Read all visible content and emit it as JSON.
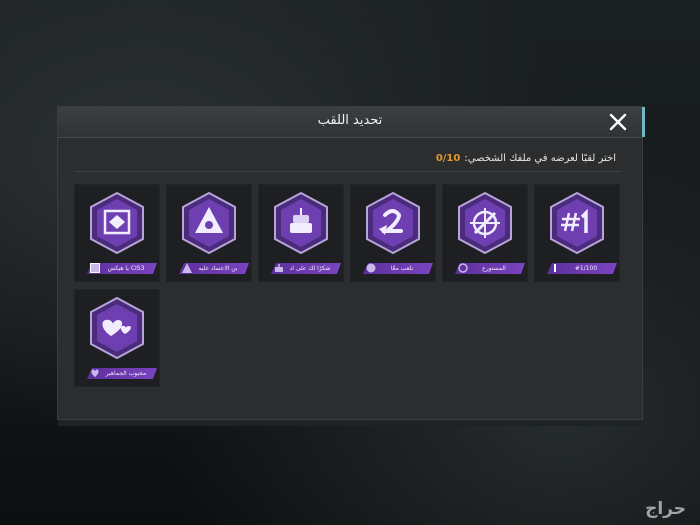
{
  "dialog": {
    "title": "تحديد اللقب",
    "instruction": "اختر لقبًا لعرضه في ملفك الشخصي:",
    "count": "0/10"
  },
  "titles": [
    {
      "label": "CIS3 يا هيكس",
      "icon": "cube-icon"
    },
    {
      "label": "بن الاعتماد عليه",
      "icon": "pyramid-eye-icon"
    },
    {
      "label": "شكرًا لك على اد",
      "icon": "cake-icon"
    },
    {
      "label": "نلعب معًا",
      "icon": "two-player-icon"
    },
    {
      "label": "المستورع",
      "icon": "crosshair-icon"
    },
    {
      "label": "#1/100",
      "icon": "rank-one-icon"
    },
    {
      "label": "محبوب الجماهير",
      "icon": "hearts-icon"
    }
  ],
  "watermark": "حراج",
  "colors": {
    "accent": "#e39a2d",
    "badge": "#7a44c0",
    "panel": "#2b2d2f"
  }
}
